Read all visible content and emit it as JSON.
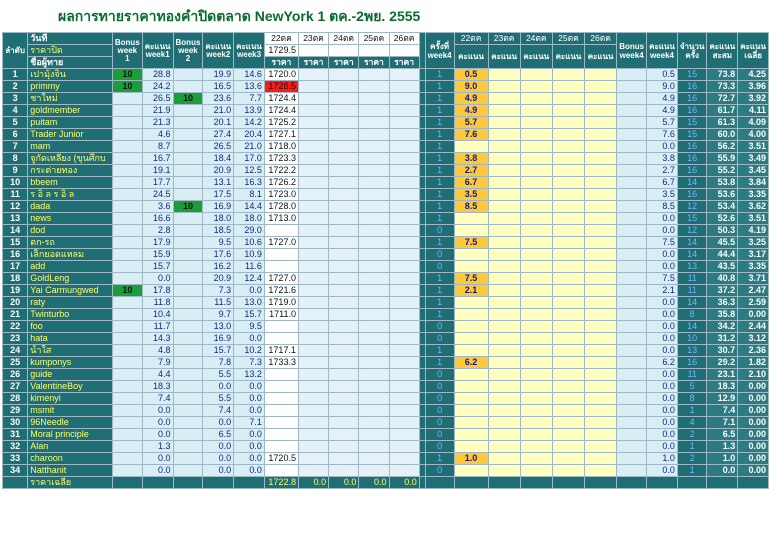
{
  "title": "ผลการทายราคาทองคำปิดตลาด NewYork 1 ตค.-2พย. 2555",
  "header": {
    "day_label": "วันที่",
    "order_label": "ลำดับ",
    "close_price_label": "ราคาปิด",
    "player_label": "ชื่อผู้ทาย",
    "bonus1": "Bonus week 1",
    "score_w1": "คะแนน week1",
    "bonus2": "Bonus week 2",
    "score_w2": "คะแนน week2",
    "score_w3": "คะแนน week3",
    "dates": [
      "22ตค",
      "23ตค",
      "24ตค",
      "25ตค",
      "26ตค"
    ],
    "price_label": "ราคา",
    "times_week4": "ครั้งที่ week4",
    "score_label": "คะแนน",
    "bonus_week4": "Bonus week4",
    "score_week4": "คะแนน week4",
    "count_label": "จำนวนครั้ง",
    "total_label": "คะแนนสะสม",
    "avg_label": "คะแนนเฉลี่ย",
    "close_values": [
      "1729.5",
      "",
      "",
      "",
      ""
    ]
  },
  "rows": [
    {
      "no": "1",
      "name": "เปามุ้งจิ๋น",
      "b1": "10",
      "w1": "28.8",
      "b2": "",
      "w2": "19.9",
      "w3": "14.6",
      "p": "1720.0",
      "pr": false,
      "t": "1",
      "s": "0.5",
      "w4": "0.5",
      "n": "15",
      "tot": "73.8",
      "avg": "4.25"
    },
    {
      "no": "2",
      "name": "primmy",
      "b1": "10",
      "w1": "24.2",
      "b2": "",
      "w2": "16.5",
      "w3": "13.6",
      "p": "1728.5",
      "pr": true,
      "t": "1",
      "s": "9.0",
      "w4": "9.0",
      "n": "16",
      "tot": "73.3",
      "avg": "3.96"
    },
    {
      "no": "3",
      "name": "ชาใหม่",
      "b1": "",
      "w1": "26.5",
      "b2": "10",
      "w2": "23.6",
      "w3": "7.7",
      "p": "1724.4",
      "pr": false,
      "t": "1",
      "s": "4.9",
      "w4": "4.9",
      "n": "16",
      "tot": "72.7",
      "avg": "3.92"
    },
    {
      "no": "4",
      "name": "goldmember",
      "b1": "",
      "w1": "21.9",
      "b2": "",
      "w2": "21.0",
      "w3": "13.9",
      "p": "1724.4",
      "pr": false,
      "t": "1",
      "s": "4.9",
      "w4": "4.9",
      "n": "16",
      "tot": "61.7",
      "avg": "4.11"
    },
    {
      "no": "5",
      "name": "puitam",
      "b1": "",
      "w1": "21.3",
      "b2": "",
      "w2": "20.1",
      "w3": "14.2",
      "p": "1725.2",
      "pr": false,
      "t": "1",
      "s": "5.7",
      "w4": "5.7",
      "n": "15",
      "tot": "61.3",
      "avg": "4.09"
    },
    {
      "no": "6",
      "name": "Trader Junior",
      "b1": "",
      "w1": "4.6",
      "b2": "",
      "w2": "27.4",
      "w3": "20.4",
      "p": "1727.1",
      "pr": false,
      "t": "1",
      "s": "7.6",
      "w4": "7.6",
      "n": "15",
      "tot": "60.0",
      "avg": "4.00"
    },
    {
      "no": "7",
      "name": "mam",
      "b1": "",
      "w1": "8.7",
      "b2": "",
      "w2": "26.5",
      "w3": "21.0",
      "p": "1718.0",
      "pr": false,
      "t": "1",
      "s": "",
      "w4": "0.0",
      "n": "16",
      "tot": "56.2",
      "avg": "3.51"
    },
    {
      "no": "8",
      "name": "จูกัดเหลียง (ขุนศึกบ",
      "b1": "",
      "w1": "16.7",
      "b2": "",
      "w2": "18.4",
      "w3": "17.0",
      "p": "1723.3",
      "pr": false,
      "t": "1",
      "s": "3.8",
      "w4": "3.8",
      "n": "16",
      "tot": "55.9",
      "avg": "3.49"
    },
    {
      "no": "9",
      "name": "กระต่ายทอง",
      "b1": "",
      "w1": "19.1",
      "b2": "",
      "w2": "20.9",
      "w3": "12.5",
      "p": "1722.2",
      "pr": false,
      "t": "1",
      "s": "2.7",
      "w4": "2.7",
      "n": "16",
      "tot": "55.2",
      "avg": "3.45"
    },
    {
      "no": "10",
      "name": "bbeem",
      "b1": "",
      "w1": "17.7",
      "b2": "",
      "w2": "13.1",
      "w3": "16.3",
      "p": "1726.2",
      "pr": false,
      "t": "1",
      "s": "6.7",
      "w4": "6.7",
      "n": "14",
      "tot": "53.8",
      "avg": "3.84"
    },
    {
      "no": "11",
      "name": "ร อิ ล ร อิ ล",
      "b1": "",
      "w1": "24.5",
      "b2": "",
      "w2": "17.5",
      "w3": "8.1",
      "p": "1723.0",
      "pr": false,
      "t": "1",
      "s": "3.5",
      "w4": "3.5",
      "n": "16",
      "tot": "53.6",
      "avg": "3.35"
    },
    {
      "no": "12",
      "name": "dada",
      "b1": "",
      "w1": "3.6",
      "b2": "10",
      "w2": "16.9",
      "w3": "14.4",
      "p": "1728.0",
      "pr": false,
      "t": "1",
      "s": "8.5",
      "w4": "8.5",
      "n": "12",
      "tot": "53.4",
      "avg": "3.62"
    },
    {
      "no": "13",
      "name": "news",
      "b1": "",
      "w1": "16.6",
      "b2": "",
      "w2": "18.0",
      "w3": "18.0",
      "p": "1713.0",
      "pr": false,
      "t": "1",
      "s": "",
      "w4": "0.0",
      "n": "15",
      "tot": "52.6",
      "avg": "3.51"
    },
    {
      "no": "14",
      "name": "dod",
      "b1": "",
      "w1": "2.8",
      "b2": "",
      "w2": "18.5",
      "w3": "29.0",
      "p": "",
      "pr": false,
      "t": "0",
      "s": "",
      "w4": "0.0",
      "n": "12",
      "tot": "50.3",
      "avg": "4.19"
    },
    {
      "no": "15",
      "name": "ตก-รถ",
      "b1": "",
      "w1": "17.9",
      "b2": "",
      "w2": "9.5",
      "w3": "10.6",
      "p": "1727.0",
      "pr": false,
      "t": "1",
      "s": "7.5",
      "w4": "7.5",
      "n": "14",
      "tot": "45.5",
      "avg": "3.25"
    },
    {
      "no": "16",
      "name": "เล็กยอดแหลม",
      "b1": "",
      "w1": "15.9",
      "b2": "",
      "w2": "17.6",
      "w3": "10.9",
      "p": "",
      "pr": false,
      "t": "0",
      "s": "",
      "w4": "0.0",
      "n": "14",
      "tot": "44.4",
      "avg": "3.17"
    },
    {
      "no": "17",
      "name": "add",
      "b1": "",
      "w1": "15.7",
      "b2": "",
      "w2": "16.2",
      "w3": "11.6",
      "p": "",
      "pr": false,
      "t": "0",
      "s": "",
      "w4": "0.0",
      "n": "13",
      "tot": "43.5",
      "avg": "3.35"
    },
    {
      "no": "18",
      "name": "GoldLeng",
      "b1": "",
      "w1": "0.0",
      "b2": "",
      "w2": "20.9",
      "w3": "12.4",
      "p": "1727.0",
      "pr": false,
      "t": "1",
      "s": "7.5",
      "w4": "7.5",
      "n": "11",
      "tot": "40.8",
      "avg": "3.71"
    },
    {
      "no": "19",
      "name": "Yai Carmungwed",
      "b1": "10",
      "w1": "17.8",
      "b2": "",
      "w2": "7.3",
      "w3": "0.0",
      "p": "1721.6",
      "pr": false,
      "t": "1",
      "s": "2.1",
      "w4": "2.1",
      "n": "11",
      "tot": "37.2",
      "avg": "2.47"
    },
    {
      "no": "20",
      "name": "raty",
      "b1": "",
      "w1": "11.8",
      "b2": "",
      "w2": "11.5",
      "w3": "13.0",
      "p": "1719.0",
      "pr": false,
      "t": "1",
      "s": "",
      "w4": "0.0",
      "n": "14",
      "tot": "36.3",
      "avg": "2.59"
    },
    {
      "no": "21",
      "name": "Twinturbo",
      "b1": "",
      "w1": "10.4",
      "b2": "",
      "w2": "9.7",
      "w3": "15.7",
      "p": "1711.0",
      "pr": false,
      "t": "1",
      "s": "",
      "w4": "0.0",
      "n": "8",
      "tot": "35.8",
      "avg": "0.00"
    },
    {
      "no": "22",
      "name": "foo",
      "b1": "",
      "w1": "11.7",
      "b2": "",
      "w2": "13.0",
      "w3": "9.5",
      "p": "",
      "pr": false,
      "t": "0",
      "s": "",
      "w4": "0.0",
      "n": "14",
      "tot": "34.2",
      "avg": "2.44"
    },
    {
      "no": "23",
      "name": "hata",
      "b1": "",
      "w1": "14.3",
      "b2": "",
      "w2": "16.9",
      "w3": "0.0",
      "p": "",
      "pr": false,
      "t": "0",
      "s": "",
      "w4": "0.0",
      "n": "10",
      "tot": "31.2",
      "avg": "3.12"
    },
    {
      "no": "24",
      "name": "น้ำใส",
      "b1": "",
      "w1": "4.8",
      "b2": "",
      "w2": "15.7",
      "w3": "10.2",
      "p": "1717.1",
      "pr": false,
      "t": "1",
      "s": "",
      "w4": "0.0",
      "n": "13",
      "tot": "30.7",
      "avg": "2.36"
    },
    {
      "no": "25",
      "name": "kumponys",
      "b1": "",
      "w1": "7.9",
      "b2": "",
      "w2": "7.8",
      "w3": "7.3",
      "p": "1733.3",
      "pr": false,
      "t": "1",
      "s": "6.2",
      "w4": "6.2",
      "n": "16",
      "tot": "29.2",
      "avg": "1.82"
    },
    {
      "no": "26",
      "name": "guide",
      "b1": "",
      "w1": "4.4",
      "b2": "",
      "w2": "5.5",
      "w3": "13.2",
      "p": "",
      "pr": false,
      "t": "0",
      "s": "",
      "w4": "0.0",
      "n": "11",
      "tot": "23.1",
      "avg": "2.10"
    },
    {
      "no": "27",
      "name": "ValentineBoy",
      "b1": "",
      "w1": "18.3",
      "b2": "",
      "w2": "0.0",
      "w3": "0.0",
      "p": "",
      "pr": false,
      "t": "0",
      "s": "",
      "w4": "0.0",
      "n": "5",
      "tot": "18.3",
      "avg": "0.00"
    },
    {
      "no": "28",
      "name": "kimenyi",
      "b1": "",
      "w1": "7.4",
      "b2": "",
      "w2": "5.5",
      "w3": "0.0",
      "p": "",
      "pr": false,
      "t": "0",
      "s": "",
      "w4": "0.0",
      "n": "8",
      "tot": "12.9",
      "avg": "0.00"
    },
    {
      "no": "29",
      "name": "msmit",
      "b1": "",
      "w1": "0.0",
      "b2": "",
      "w2": "7.4",
      "w3": "0.0",
      "p": "",
      "pr": false,
      "t": "0",
      "s": "",
      "w4": "0.0",
      "n": "1",
      "tot": "7.4",
      "avg": "0.00"
    },
    {
      "no": "30",
      "name": "96Needle",
      "b1": "",
      "w1": "0.0",
      "b2": "",
      "w2": "0.0",
      "w3": "7.1",
      "p": "",
      "pr": false,
      "t": "0",
      "s": "",
      "w4": "0.0",
      "n": "4",
      "tot": "7.1",
      "avg": "0.00"
    },
    {
      "no": "31",
      "name": "Moral principle",
      "b1": "",
      "w1": "0.0",
      "b2": "",
      "w2": "6.5",
      "w3": "0.0",
      "p": "",
      "pr": false,
      "t": "0",
      "s": "",
      "w4": "0.0",
      "n": "2",
      "tot": "6.5",
      "avg": "0.00"
    },
    {
      "no": "32",
      "name": "Alan",
      "b1": "",
      "w1": "1.3",
      "b2": "",
      "w2": "0.0",
      "w3": "0.0",
      "p": "",
      "pr": false,
      "t": "0",
      "s": "",
      "w4": "0.0",
      "n": "1",
      "tot": "1.3",
      "avg": "0.00"
    },
    {
      "no": "33",
      "name": "charoon",
      "b1": "",
      "w1": "0.0",
      "b2": "",
      "w2": "0.0",
      "w3": "0.0",
      "p": "1720.5",
      "pr": false,
      "t": "1",
      "s": "1.0",
      "w4": "1.0",
      "n": "2",
      "tot": "1.0",
      "avg": "0.00"
    },
    {
      "no": "34",
      "name": "Natthanit",
      "b1": "",
      "w1": "0.0",
      "b2": "",
      "w2": "0.0",
      "w3": "0.0",
      "p": "",
      "pr": false,
      "t": "0",
      "s": "",
      "w4": "0.0",
      "n": "1",
      "tot": "0.0",
      "avg": "0.00"
    }
  ],
  "footer": {
    "label": "ราคาเฉลี่ย",
    "values": [
      "1722.8",
      "0.0",
      "0.0",
      "0.0",
      "0.0"
    ]
  },
  "colors": {
    "header_teal": "#1f6e74",
    "name_yellow": "#ffff66",
    "bonus_green": "#1b9e3a",
    "score_orange": "#ffc83a",
    "score_pale": "#ffffc0",
    "price_red": "#ff1a1a"
  }
}
